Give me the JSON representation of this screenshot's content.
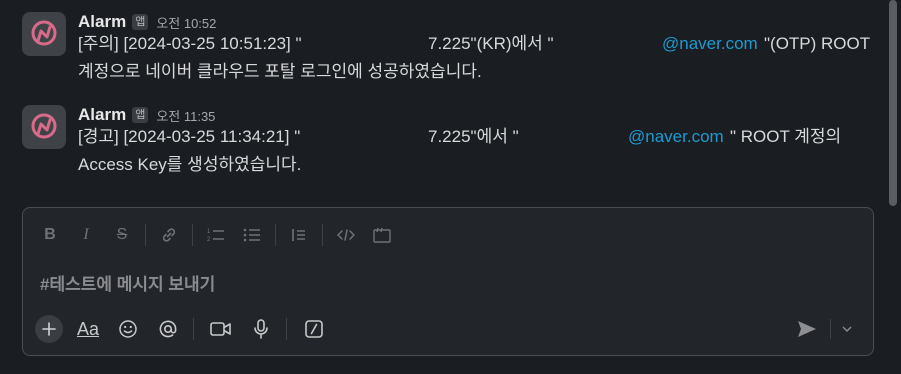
{
  "messages": [
    {
      "sender": "Alarm",
      "badge": "앱",
      "time": "오전 10:52",
      "line1_a": "[주의] [2024-03-25 10:51:23] \"",
      "line1_b": "7.225\"(KR)에서 \"",
      "line1_link": "@naver.com",
      "line1_c": "\"(OTP) ROOT",
      "line2": "계정으로 네이버 클라우드 포탈 로그인에 성공하였습니다."
    },
    {
      "sender": "Alarm",
      "badge": "앱",
      "time": "오전 11:35",
      "line1_a": "[경고] [2024-03-25 11:34:21] \"",
      "line1_b": "7.225\"에서 \"",
      "line1_link": "@naver.com",
      "line1_c": "\" ROOT 계정의",
      "line2": "Access Key를 생성하였습니다."
    }
  ],
  "composer": {
    "placeholder": "#테스트에 메시지 보내기",
    "aa_label": "Aa"
  },
  "icons": {
    "avatar": "alarm-app-avatar",
    "toolbar": [
      "bold-icon",
      "italic-icon",
      "strikethrough-icon",
      "link-icon",
      "ordered-list-icon",
      "bulleted-list-icon",
      "blockquote-icon",
      "code-icon",
      "code-block-icon"
    ],
    "bottom": [
      "plus-icon",
      "text-format-icon",
      "emoji-icon",
      "mention-icon",
      "video-icon",
      "microphone-icon",
      "slash-command-icon",
      "send-icon",
      "chevron-down-icon"
    ]
  },
  "colors": {
    "link": "#1d9bd1",
    "background": "#1a1d21"
  }
}
